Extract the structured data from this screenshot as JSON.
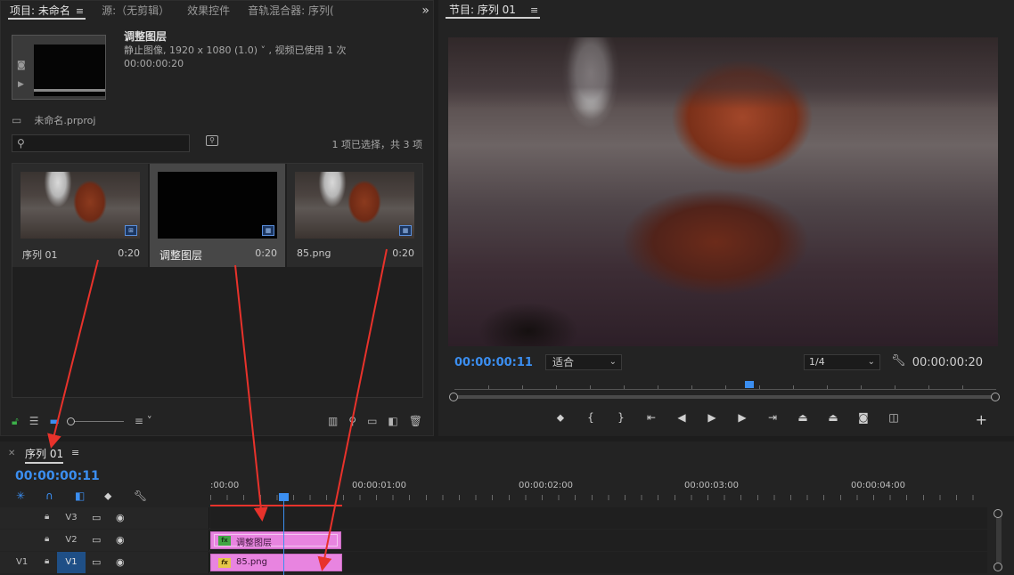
{
  "project_panel": {
    "tabs": [
      {
        "label": "项目: 未命名"
      },
      {
        "label": "源:（无剪辑）"
      },
      {
        "label": "效果控件"
      },
      {
        "label": "音轨混合器: 序列("
      }
    ],
    "more_glyph": "»",
    "selected_asset": {
      "name": "调整图层",
      "info": "静止图像, 1920 x 1080 (1.0) ˅ , 视频已使用 1 次",
      "duration": "00:00:00:20"
    },
    "project_file": "未命名.prproj",
    "search": {
      "value": "",
      "placeholder": ""
    },
    "selection_count": "1 项已选择，共 3 项",
    "items": [
      {
        "name": "序列 01",
        "duration": "0:20",
        "thumb": "photo",
        "badge": "sequence-icon"
      },
      {
        "name": "调整图层",
        "duration": "0:20",
        "thumb": "black",
        "badge": "film-icon",
        "selected": true
      },
      {
        "name": "85.png",
        "duration": "0:20",
        "thumb": "photo",
        "badge": "film-icon"
      }
    ]
  },
  "program_monitor": {
    "title": "节目: 序列 01",
    "current_timecode": "00:00:00:11",
    "fit": "适合",
    "resolution": "1/4",
    "duration_timecode": "00:00:00:20"
  },
  "timeline": {
    "sequence_name": "序列 01",
    "current_timecode": "00:00:00:11",
    "ruler_labels": [
      ":00:00",
      "00:00:01:00",
      "00:00:02:00",
      "00:00:03:00",
      "00:00:04:00"
    ],
    "tracks": [
      {
        "name": "V3",
        "source": "",
        "targeted": false
      },
      {
        "name": "V2",
        "source": "",
        "targeted": false
      },
      {
        "name": "V1",
        "source": "V1",
        "targeted": true
      }
    ],
    "clips": [
      {
        "track": "V2",
        "name": "调整图层",
        "fx": "fx"
      },
      {
        "track": "V1",
        "name": "85.png",
        "fx": "fx"
      }
    ]
  },
  "colors": {
    "accent": "#3b8ef0",
    "clip": "#e884e0",
    "arrow": "#e8322b",
    "work_area": "#e8322b"
  }
}
